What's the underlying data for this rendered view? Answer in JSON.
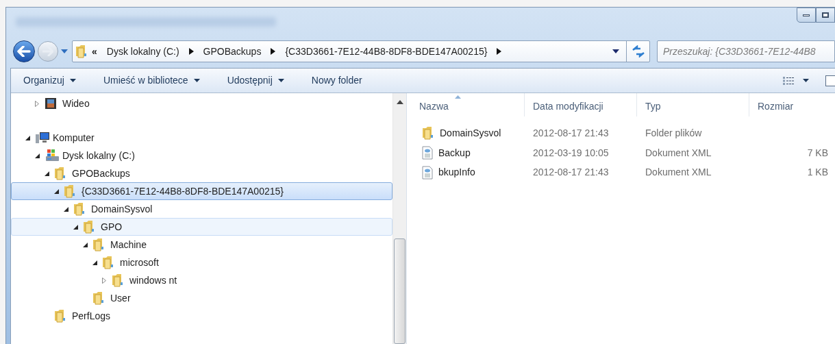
{
  "address_bar": {
    "overflow": "«",
    "segments": [
      "Dysk lokalny (C:)",
      "GPOBackups",
      "{C33D3661-7E12-44B8-8DF8-BDE147A00215}"
    ]
  },
  "search": {
    "placeholder": "Przeszukaj: {C33D3661-7E12-44B8"
  },
  "toolbar": [
    {
      "label": "Organizuj",
      "dropdown": true
    },
    {
      "label": "Umieść w bibliotece",
      "dropdown": true
    },
    {
      "label": "Udostępnij",
      "dropdown": true
    },
    {
      "label": "Nowy folder",
      "dropdown": false
    }
  ],
  "nav_tree": {
    "libraries_tail": [
      {
        "label": "Wideo",
        "kind": "video",
        "expanded": false,
        "selected": false,
        "hovered": false
      }
    ],
    "items": [
      {
        "label": "Komputer",
        "kind": "computer",
        "expanded": true,
        "selected": false,
        "hovered": false,
        "children": [
          {
            "label": "Dysk lokalny (C:)",
            "kind": "drive",
            "expanded": true,
            "selected": false,
            "hovered": false,
            "children": [
              {
                "label": "GPOBackups",
                "kind": "folder",
                "expanded": true,
                "selected": false,
                "hovered": false,
                "children": [
                  {
                    "label": "{C33D3661-7E12-44B8-8DF8-BDE147A00215}",
                    "kind": "folder",
                    "expanded": true,
                    "selected": true,
                    "hovered": false,
                    "children": [
                      {
                        "label": "DomainSysvol",
                        "kind": "folder",
                        "expanded": true,
                        "selected": false,
                        "hovered": false,
                        "children": [
                          {
                            "label": "GPO",
                            "kind": "folder",
                            "expanded": true,
                            "selected": false,
                            "hovered": true,
                            "children": [
                              {
                                "label": "Machine",
                                "kind": "folder",
                                "expanded": true,
                                "selected": false,
                                "hovered": false,
                                "children": [
                                  {
                                    "label": "microsoft",
                                    "kind": "folder",
                                    "expanded": true,
                                    "selected": false,
                                    "hovered": false,
                                    "children": [
                                      {
                                        "label": "windows nt",
                                        "kind": "folder",
                                        "expanded": false,
                                        "selected": false,
                                        "hovered": false
                                      }
                                    ]
                                  }
                                ]
                              },
                              {
                                "label": "User",
                                "kind": "folder",
                                "selected": false,
                                "hovered": false
                              }
                            ]
                          }
                        ]
                      }
                    ]
                  }
                ]
              },
              {
                "label": "PerfLogs",
                "kind": "folder",
                "selected": false,
                "hovered": false
              }
            ]
          }
        ]
      }
    ]
  },
  "file_list": {
    "columns": [
      {
        "label": "Nazwa",
        "sorted": true
      },
      {
        "label": "Data modyfikacji",
        "sorted": false
      },
      {
        "label": "Typ",
        "sorted": false
      },
      {
        "label": "Rozmiar",
        "sorted": false
      }
    ],
    "rows": [
      {
        "kind": "folder",
        "name": "DomainSysvol",
        "modified": "2012-08-17 21:43",
        "type": "Folder plików"
      },
      {
        "kind": "xml",
        "name": "Backup",
        "modified": "2012-03-19 10:05",
        "type": "Dokument XML",
        "size": "7 KB"
      },
      {
        "kind": "xml",
        "name": "bkupInfo",
        "modified": "2012-08-17 21:43",
        "type": "Dokument XML",
        "size": "1 KB"
      }
    ]
  }
}
